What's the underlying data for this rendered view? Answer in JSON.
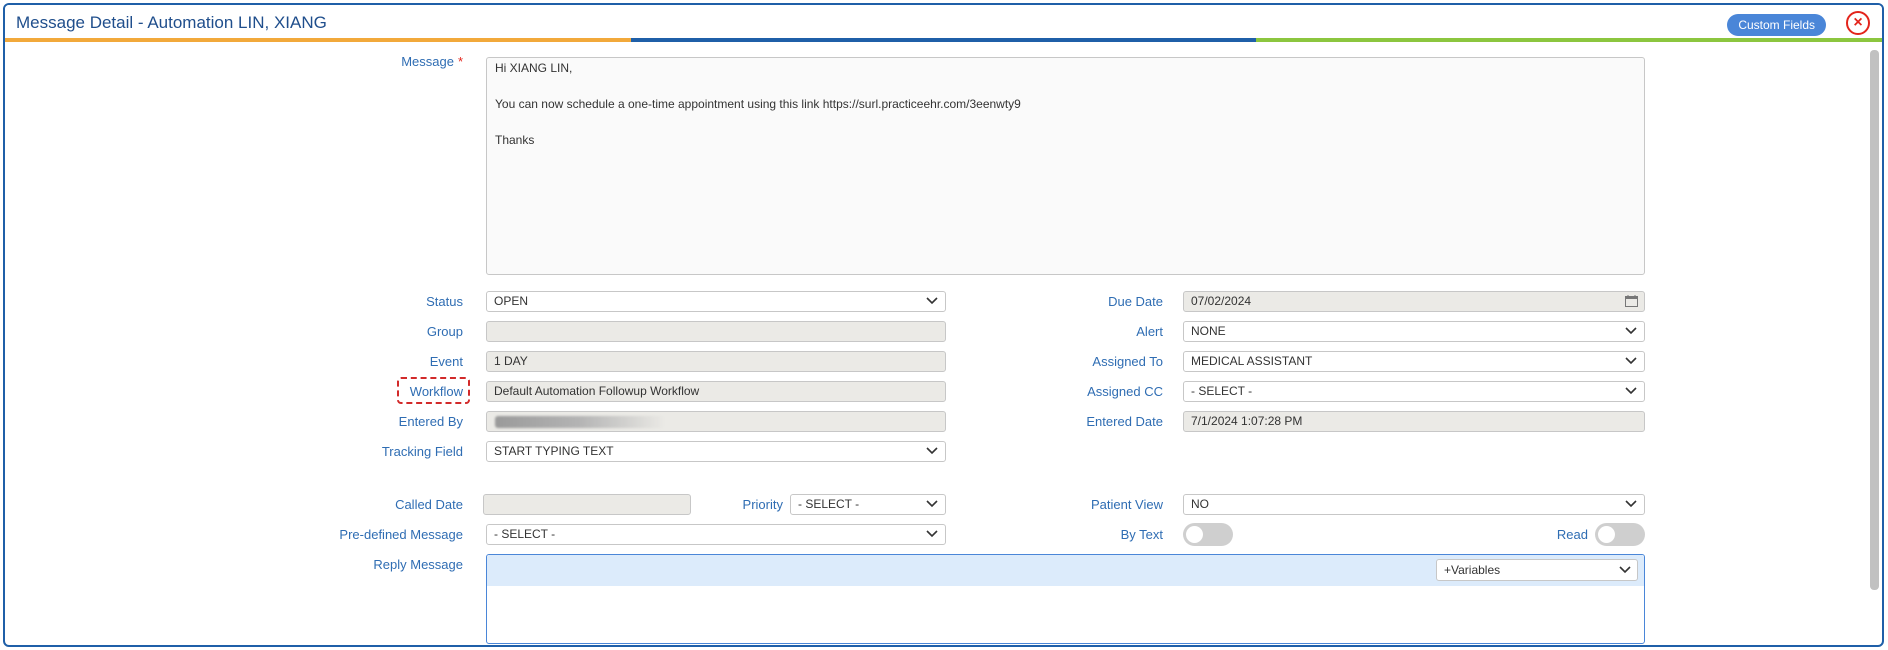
{
  "window": {
    "title": "Message Detail - Automation LIN, XIANG",
    "custom_fields_label": "Custom Fields",
    "close_symbol": "×"
  },
  "strip_colors": [
    "#f2a93b",
    "#1f5fa8",
    "#8cc63f"
  ],
  "message": {
    "label": "Message",
    "required_mark": "*",
    "lines": [
      "Hi XIANG LIN,",
      "You can now schedule a one-time appointment using this link https://surl.practiceehr.com/3eenwty9",
      "Thanks"
    ]
  },
  "left_fields": {
    "status": {
      "label": "Status",
      "value": "OPEN"
    },
    "group": {
      "label": "Group",
      "value": ""
    },
    "event": {
      "label": "Event",
      "value": "1 DAY"
    },
    "workflow": {
      "label": "Workflow",
      "value": "Default Automation Followup Workflow"
    },
    "entered_by": {
      "label": "Entered By",
      "value": ""
    },
    "tracking_field": {
      "label": "Tracking Field",
      "value": "START TYPING TEXT"
    },
    "called_date": {
      "label": "Called Date",
      "value": ""
    },
    "priority": {
      "label": "Priority",
      "value": "- SELECT -"
    },
    "predefined": {
      "label": "Pre-defined Message",
      "value": "- SELECT -"
    },
    "reply": {
      "label": "Reply Message"
    }
  },
  "right_fields": {
    "due_date": {
      "label": "Due Date",
      "value": "07/02/2024"
    },
    "alert": {
      "label": "Alert",
      "value": "NONE"
    },
    "assigned_to": {
      "label": "Assigned To",
      "value": "MEDICAL ASSISTANT"
    },
    "assigned_cc": {
      "label": "Assigned CC",
      "value": "- SELECT -"
    },
    "entered_date": {
      "label": "Entered Date",
      "value": "7/1/2024 1:07:28 PM"
    },
    "patient_view": {
      "label": "Patient View",
      "value": "NO"
    },
    "by_text": {
      "label": "By Text"
    },
    "read": {
      "label": "Read"
    }
  },
  "reply_variables": {
    "value": "+Variables"
  },
  "icons": {
    "chevron": "chevron-down-icon",
    "calendar": "calendar-icon",
    "close": "close-icon"
  }
}
